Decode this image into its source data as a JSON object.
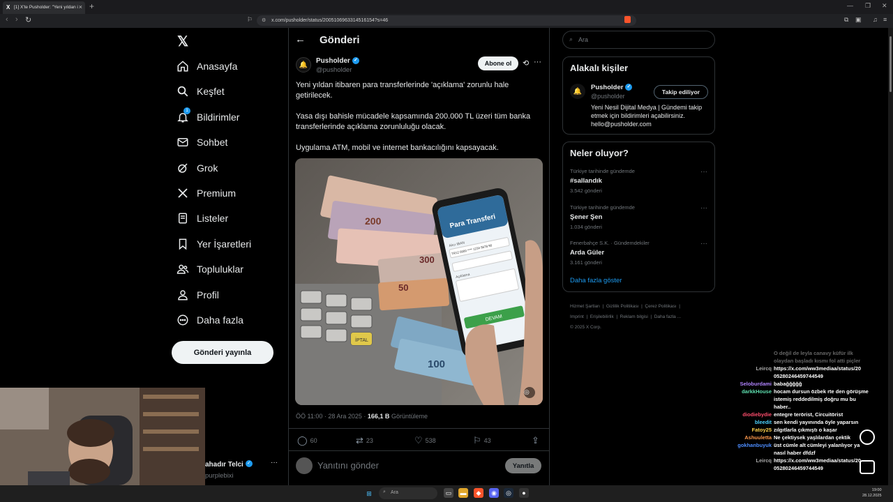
{
  "browser": {
    "tab_title": "[1] X'te Pusholder: \"Yeni yıldan i",
    "url": "x.com/pusholder/status/2005106963314516154?s=46"
  },
  "nav": {
    "items": [
      {
        "label": "Anasayfa",
        "icon": "home-icon"
      },
      {
        "label": "Keşfet",
        "icon": "search-icon"
      },
      {
        "label": "Bildirimler",
        "icon": "bell-icon",
        "badge": "1"
      },
      {
        "label": "Sohbet",
        "icon": "mail-icon"
      },
      {
        "label": "Grok",
        "icon": "grok-icon"
      },
      {
        "label": "Premium",
        "icon": "x-logo-icon"
      },
      {
        "label": "Listeler",
        "icon": "list-icon"
      },
      {
        "label": "Yer İşaretleri",
        "icon": "bookmark-icon"
      },
      {
        "label": "Topluluklar",
        "icon": "people-icon"
      },
      {
        "label": "Profil",
        "icon": "person-icon"
      },
      {
        "label": "Daha fazla",
        "icon": "more-circle-icon"
      }
    ],
    "post_button": "Gönderi yayınla"
  },
  "account": {
    "name": "ahadır Telci",
    "handle": "purplebixi"
  },
  "header": {
    "title": "Gönderi"
  },
  "tweet": {
    "author": "Pusholder",
    "handle": "@pusholder",
    "subscribe": "Abone ol",
    "paragraphs": [
      "Yeni yıldan itibaren para transferlerinde 'açıklama' zorunlu hale getirilecek.",
      "Yasa dışı bahisle mücadele kapsamında 200.000 TL üzeri tüm banka transferlerinde açıklama zorunluluğu olacak.",
      "Uygulama ATM, mobil ve internet bankacılığını kapsayacak."
    ],
    "image": {
      "phone_title": "Para Transferi",
      "iban_label": "Alıcı IBAN",
      "iban_value": "TR12 0000 **** 1234 5678 90",
      "desc_label": "Açıklama",
      "button": "DEVAM",
      "keys": [
        "İPTAL",
        "İPTAL"
      ]
    },
    "time": "ÖÖ 11:00 · 28 Ara 2025 · ",
    "views": "166,1 B",
    "views_label": " Görüntüleme",
    "stats": {
      "replies": "60",
      "retweets": "23",
      "likes": "538",
      "bookmarks": "43"
    },
    "reply_placeholder": "Yanıtını gönder",
    "reply_button": "Yanıtla"
  },
  "sidebar": {
    "search_placeholder": "Ara",
    "people_title": "Alakalı kişiler",
    "person": {
      "name": "Pusholder",
      "handle": "@pusholder",
      "bio": "Yeni Nesil Dijital Medya | Gündemi takip etmek için bildirimleri açabilirsiniz. hello@pusholder.com",
      "follow": "Takip ediliyor"
    },
    "trends_title": "Neler oluyor?",
    "trends": [
      {
        "context": "Türkiye tarihinde gündemde",
        "name": "#sallandık",
        "count": "3.542 gönderi"
      },
      {
        "context": "Türkiye tarihinde gündemde",
        "name": "Şener Şen",
        "count": "1.034 gönderi"
      },
      {
        "context": "Fenerbahçe S.K. · Gündemdekiler",
        "name": "Arda Güler",
        "count": "3.161 gönderi"
      }
    ],
    "show_more": "Daha fazla göster",
    "footer": [
      "Hizmet Şartları",
      "Gizlilik Politikası",
      "Çerez Politikası",
      "Imprint",
      "Erişilebilirlik",
      "Reklam bilgisi",
      "Daha fazla ...",
      "© 2025 X Corp."
    ]
  },
  "chat": [
    {
      "user": "",
      "msg": "O değil de leyla canavy küfür ilk",
      "color": "#777777"
    },
    {
      "user": "",
      "msg": "olaydan başladı kısmı fol atti piçler",
      "color": "#777777"
    },
    {
      "user": "Leircq",
      "msg": "https://x.com/ww3mediaa/status/20",
      "color": "#aaaaaa"
    },
    {
      "user": "",
      "msg": "05280246459744549",
      "color": "#aaaaaa"
    },
    {
      "user": "Seloburdami",
      "msg": "babağğğğğ",
      "color": "#b084ff"
    },
    {
      "user": "darkkHouse",
      "msg": "hocam dursun özbek rte den görüşme",
      "color": "#5ee0b0"
    },
    {
      "user": "",
      "msg": "istemiş reddedilmiş doğru mu bu",
      "color": "#5ee0b0"
    },
    {
      "user": "",
      "msg": "haber..",
      "color": "#5ee0b0"
    },
    {
      "user": "diodiebydie",
      "msg": "entegre terörist, Circuitörist",
      "color": "#ff4d6d"
    },
    {
      "user": "bleedit",
      "msg": "sen kendi yayınında öyle yaparsın",
      "color": "#4dd2ff"
    },
    {
      "user": "Fatoy25",
      "msg": "zılgıtlarla çıkmıştı o kaşar",
      "color": "#ffd24d"
    },
    {
      "user": "Ashuuletta",
      "msg": "Ne çektiysek yaşlılardan çektik",
      "color": "#ff9a4d"
    },
    {
      "user": "gokhanbuyuk",
      "msg": "üst cümle alt cümleyi yalanlıyor ya",
      "color": "#4d8dff"
    },
    {
      "user": "",
      "msg": "nasıl haber dfdzf",
      "color": "#4d8dff"
    },
    {
      "user": "Leircq",
      "msg": "https://x.com/ww3mediaa/status/20",
      "color": "#aaaaaa"
    },
    {
      "user": "",
      "msg": "05280246459744549",
      "color": "#aaaaaa"
    }
  ],
  "taskbar": {
    "search": "Ara",
    "time": "19:00",
    "date": "28.12.2025"
  }
}
